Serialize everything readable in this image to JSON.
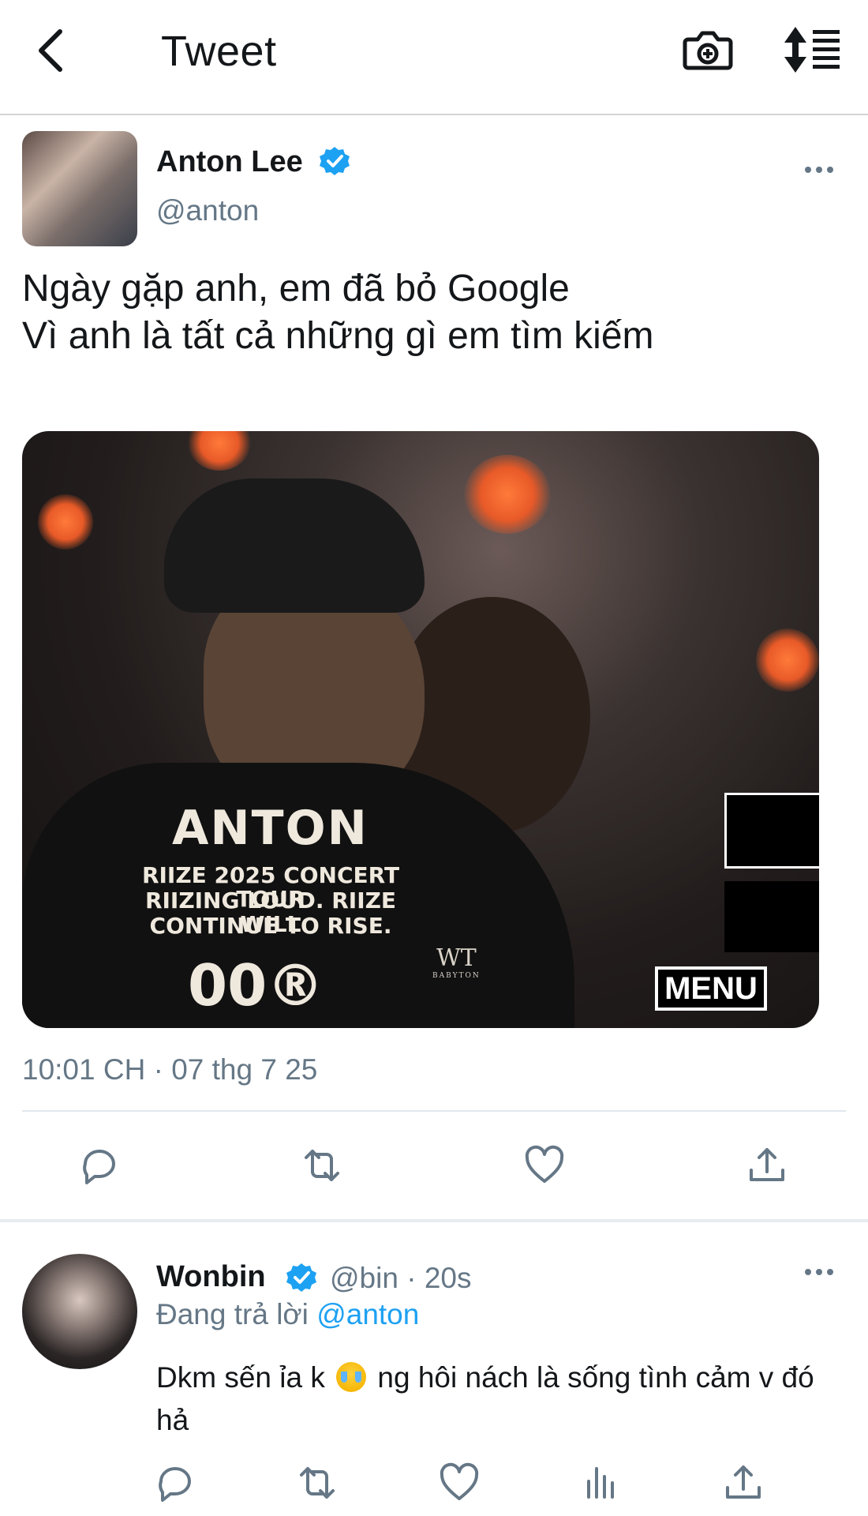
{
  "header": {
    "title": "Tweet",
    "back_icon": "chevron-left-icon",
    "camera_icon": "camera-plus-icon",
    "sort_icon": "sort-lines-icon"
  },
  "tweet": {
    "author_name": "Anton Lee",
    "author_handle": "@anton",
    "verified": true,
    "text_lines": [
      "Ngày gặp anh, em đã bỏ Google",
      "Vì anh là tất cả những gì em tìm kiếm"
    ],
    "media": {
      "shirt_name": "ANTON",
      "shirt_lines": [
        "RIIZE 2025 CONCERT TOUR",
        "RIIZING LOUD. RIIZE WILL",
        "CONTINUE TO RISE."
      ],
      "shirt_number": "00®",
      "watermark": "WT",
      "watermark_sub": "BABYTON",
      "overlay_label": "MENU"
    },
    "timestamp": "10:01 CH · 07 thg 7 25",
    "actions": [
      "reply-icon",
      "retweet-icon",
      "like-icon",
      "share-icon"
    ]
  },
  "reply": {
    "author_name": "Wonbin",
    "verified": true,
    "meta": "@bin · 20s",
    "replying_prefix": "Đang trả lời",
    "replying_to": "@anton",
    "text_before_emoji": "Dkm sến ỉa k",
    "emoji": "loudly-crying-face",
    "text_after_emoji": "ng hôi nách là sống tình cảm v đó hả",
    "actions": [
      "reply-icon",
      "retweet-icon",
      "like-icon",
      "analytics-icon",
      "share-icon"
    ]
  },
  "colors": {
    "accent": "#1da1f2",
    "secondary_text": "#657786",
    "primary_text": "#14171a",
    "divider": "#e1e8ed"
  }
}
